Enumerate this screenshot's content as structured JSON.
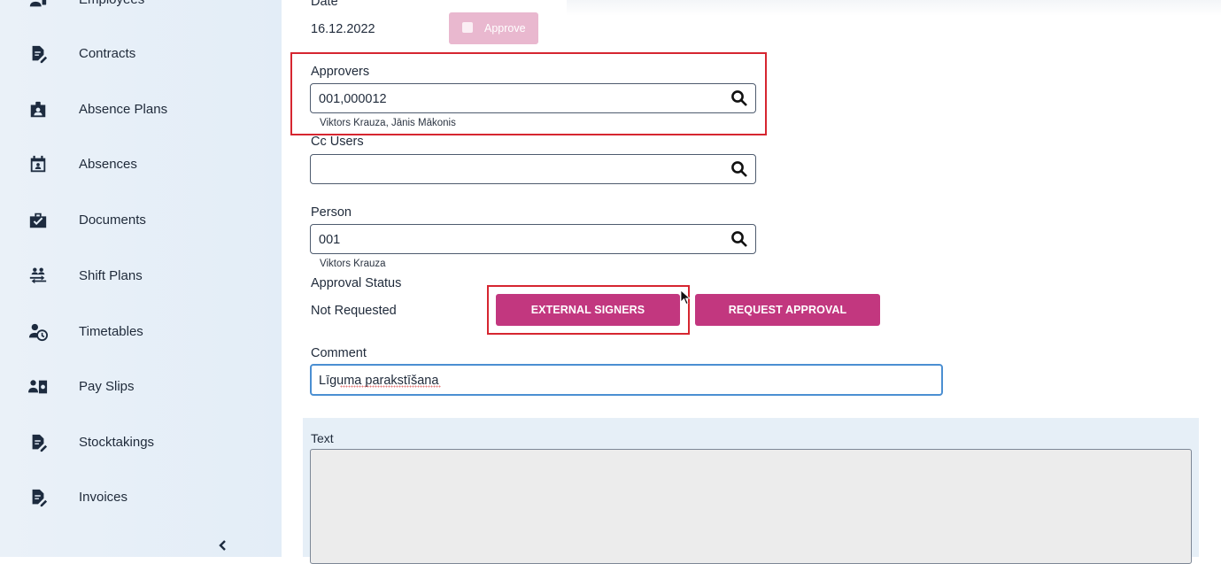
{
  "sidebar": {
    "items": [
      {
        "label": "Employees",
        "icon": "person-badge-icon"
      },
      {
        "label": "Contracts",
        "icon": "document-edit-icon"
      },
      {
        "label": "Absence Plans",
        "icon": "badge-icon"
      },
      {
        "label": "Absences",
        "icon": "calendar-person-icon"
      },
      {
        "label": "Documents",
        "icon": "briefcase-check-icon"
      },
      {
        "label": "Shift Plans",
        "icon": "people-arrows-icon"
      },
      {
        "label": "Timetables",
        "icon": "person-clock-icon"
      },
      {
        "label": "Pay Slips",
        "icon": "person-money-icon"
      },
      {
        "label": "Stocktakings",
        "icon": "document-edit-icon"
      },
      {
        "label": "Invoices",
        "icon": "document-edit-icon"
      }
    ],
    "collapse_icon": "chevron-left-icon"
  },
  "form": {
    "date_label": "Date",
    "date_value": "16.12.2022",
    "approve_label": "Approve",
    "approvers_label": "Approvers",
    "approvers_value": "001,000012",
    "approvers_names": "Viktors Krauza, Jānis Mākonis",
    "cc_label": "Cc Users",
    "cc_value": "",
    "person_label": "Person",
    "person_value": "001",
    "person_name": "Viktors Krauza",
    "approval_status_label": "Approval Status",
    "approval_status_value": "Not Requested",
    "external_signers_label": "EXTERNAL SIGNERS",
    "request_approval_label": "REQUEST APPROVAL",
    "comment_label": "Comment",
    "comment_value": "Līguma parakstīšana",
    "text_label": "Text"
  },
  "colors": {
    "accent": "#c2377f",
    "accent_disabled": "#e9b8cf",
    "highlight": "#d62630",
    "sidebar_bg": "#e6eff7"
  }
}
